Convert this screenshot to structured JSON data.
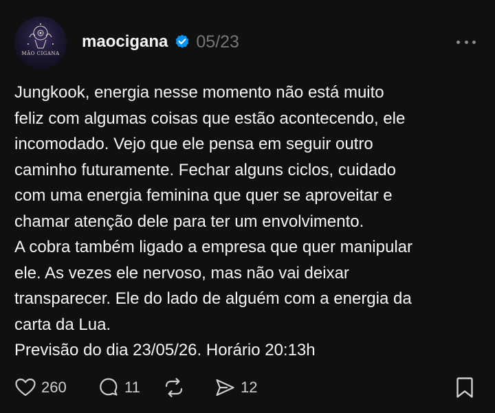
{
  "post": {
    "avatar_text": "MÃO CIGANA",
    "username": "maocigana",
    "verified": true,
    "date": "05/23",
    "text_lines": [
      "Jungkook, energia nesse momento não está muito",
      "feliz com algumas coisas que estão acontecendo, ele",
      "incomodado. Vejo que ele pensa em seguir outro",
      "caminho futuramente. Fechar alguns ciclos, cuidado",
      "com uma energia feminina que quer se aproveitar e",
      "chamar atenção dele para ter um envolvimento.",
      "A cobra também ligado a empresa que quer manipular",
      "ele. As vezes ele nervoso, mas não vai deixar",
      "transparecer. Ele do lado de alguém com a energia da",
      "carta da Lua.",
      "Previsão do dia 23/05/26. Horário 20:13h"
    ],
    "actions": {
      "likes": "260",
      "replies": "11",
      "repost": "",
      "shares": "12"
    },
    "icons": {
      "like": "heart-icon",
      "reply": "comment-icon",
      "repost": "repost-icon",
      "share": "send-icon",
      "save": "bookmark-icon",
      "more": "more-icon",
      "verified": "verified-badge-icon"
    },
    "colors": {
      "background": "#101010",
      "text": "#f3f5f7",
      "muted": "#777777",
      "verified": "#0095f6"
    }
  }
}
